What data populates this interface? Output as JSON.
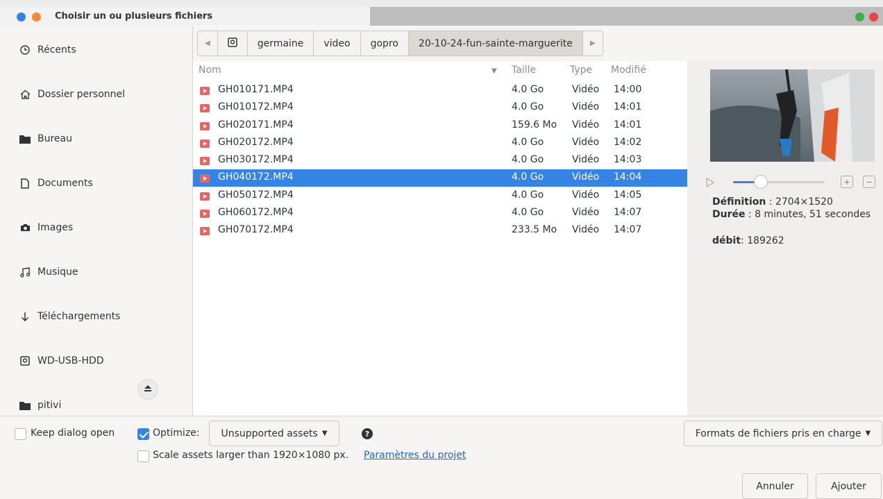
{
  "window": {
    "title": "Choisir un ou plusieurs fichiers"
  },
  "sidebar": {
    "items": [
      {
        "label": "Récents",
        "icon": "clock-icon"
      },
      {
        "label": "Dossier personnel",
        "icon": "home-icon"
      },
      {
        "label": "Bureau",
        "icon": "folder-icon"
      },
      {
        "label": "Documents",
        "icon": "document-icon"
      },
      {
        "label": "Images",
        "icon": "camera-icon"
      },
      {
        "label": "Musique",
        "icon": "music-icon"
      },
      {
        "label": "Téléchargements",
        "icon": "download-icon"
      },
      {
        "label": "WD-USB-HDD",
        "icon": "drive-icon"
      },
      {
        "label": "pitivi",
        "icon": "folder-icon"
      }
    ]
  },
  "pathbar": {
    "segments": [
      "germaine",
      "video",
      "gopro",
      "20-10-24-fun-sainte-marguerite"
    ]
  },
  "filelist": {
    "columns": {
      "name": "Nom",
      "size": "Taille",
      "type": "Type",
      "modified": "Modifié"
    },
    "rows": [
      {
        "name": "GH010171.MP4",
        "size": "4.0 Go",
        "type": "Vidéo",
        "modified": "14:00"
      },
      {
        "name": "GH010172.MP4",
        "size": "4.0 Go",
        "type": "Vidéo",
        "modified": "14:01"
      },
      {
        "name": "GH020171.MP4",
        "size": "159.6 Mo",
        "type": "Vidéo",
        "modified": "14:01"
      },
      {
        "name": "GH020172.MP4",
        "size": "4.0 Go",
        "type": "Vidéo",
        "modified": "14:02"
      },
      {
        "name": "GH030172.MP4",
        "size": "4.0 Go",
        "type": "Vidéo",
        "modified": "14:03"
      },
      {
        "name": "GH040172.MP4",
        "size": "4.0 Go",
        "type": "Vidéo",
        "modified": "14:04"
      },
      {
        "name": "GH050172.MP4",
        "size": "4.0 Go",
        "type": "Vidéo",
        "modified": "14:05"
      },
      {
        "name": "GH060172.MP4",
        "size": "4.0 Go",
        "type": "Vidéo",
        "modified": "14:07"
      },
      {
        "name": "GH070172.MP4",
        "size": "233.5 Mo",
        "type": "Vidéo",
        "modified": "14:07"
      }
    ],
    "selected_index": 5
  },
  "preview": {
    "definition_label": "Définition",
    "definition_value": " : 2704×1520",
    "duration_label": "Durée",
    "duration_value": " : 8 minutes, 51 secondes",
    "bitrate_label": "débit",
    "bitrate_value": ": 189262",
    "playback_position": 0.3
  },
  "options": {
    "keep_open_label": "Keep dialog open",
    "keep_open_checked": false,
    "optimize_label": "Optimize:",
    "optimize_checked": true,
    "optimize_select": "Unsupported assets",
    "scale_label": "Scale assets larger than 1920×1080 px.",
    "scale_checked": false,
    "project_settings_link": "Paramètres du projet",
    "formats_select": "Formats de fichiers pris en charge"
  },
  "actions": {
    "cancel": "Annuler",
    "add": "Ajouter"
  },
  "colors": {
    "accent": "#3584e4",
    "video_icon": "#e66565",
    "link": "#1b6acb"
  }
}
